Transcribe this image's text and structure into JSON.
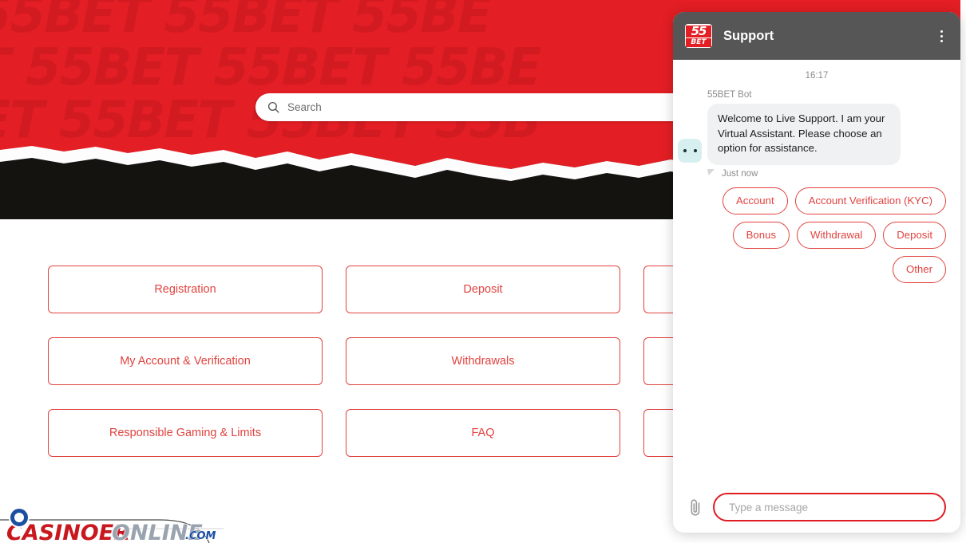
{
  "page": {
    "brand_red": "#e31e24",
    "card_red": "#e0433f",
    "hero_watermark_text": "55BET 55BET 55BET 55BET 55BET 55BET",
    "search": {
      "placeholder": "Search",
      "icon": "search-icon"
    },
    "cards": [
      {
        "label": "Registration"
      },
      {
        "label": "Deposit"
      },
      {
        "label": ""
      },
      {
        "label": "My Account & Verification"
      },
      {
        "label": "Withdrawals"
      },
      {
        "label": ""
      },
      {
        "label": "Responsible Gaming & Limits"
      },
      {
        "label": "FAQ"
      },
      {
        "label": ""
      }
    ],
    "watermark_logo": {
      "part1": "C",
      "part2": "ASINOER",
      "part3": "ONLINE",
      "part4": ".COM"
    }
  },
  "chat": {
    "header": {
      "title": "Support",
      "logo_line1": "55",
      "logo_line2": "BET",
      "menu_icon": "kebab-menu-icon"
    },
    "timestamp": "16:17",
    "message": {
      "sender": "55BET Bot",
      "text": "Welcome to Live Support. I am your Virtual Assistant. Please choose an option for assistance.",
      "status": "Just now",
      "avatar_icon": "bot-avatar-icon"
    },
    "quick_replies": [
      {
        "label": "Account"
      },
      {
        "label": "Account Verification (KYC)"
      },
      {
        "label": "Bonus"
      },
      {
        "label": "Withdrawal"
      },
      {
        "label": "Deposit"
      },
      {
        "label": "Other"
      }
    ],
    "footer": {
      "attach_icon": "paperclip-icon",
      "input_placeholder": "Type a message",
      "input_value": ""
    }
  }
}
